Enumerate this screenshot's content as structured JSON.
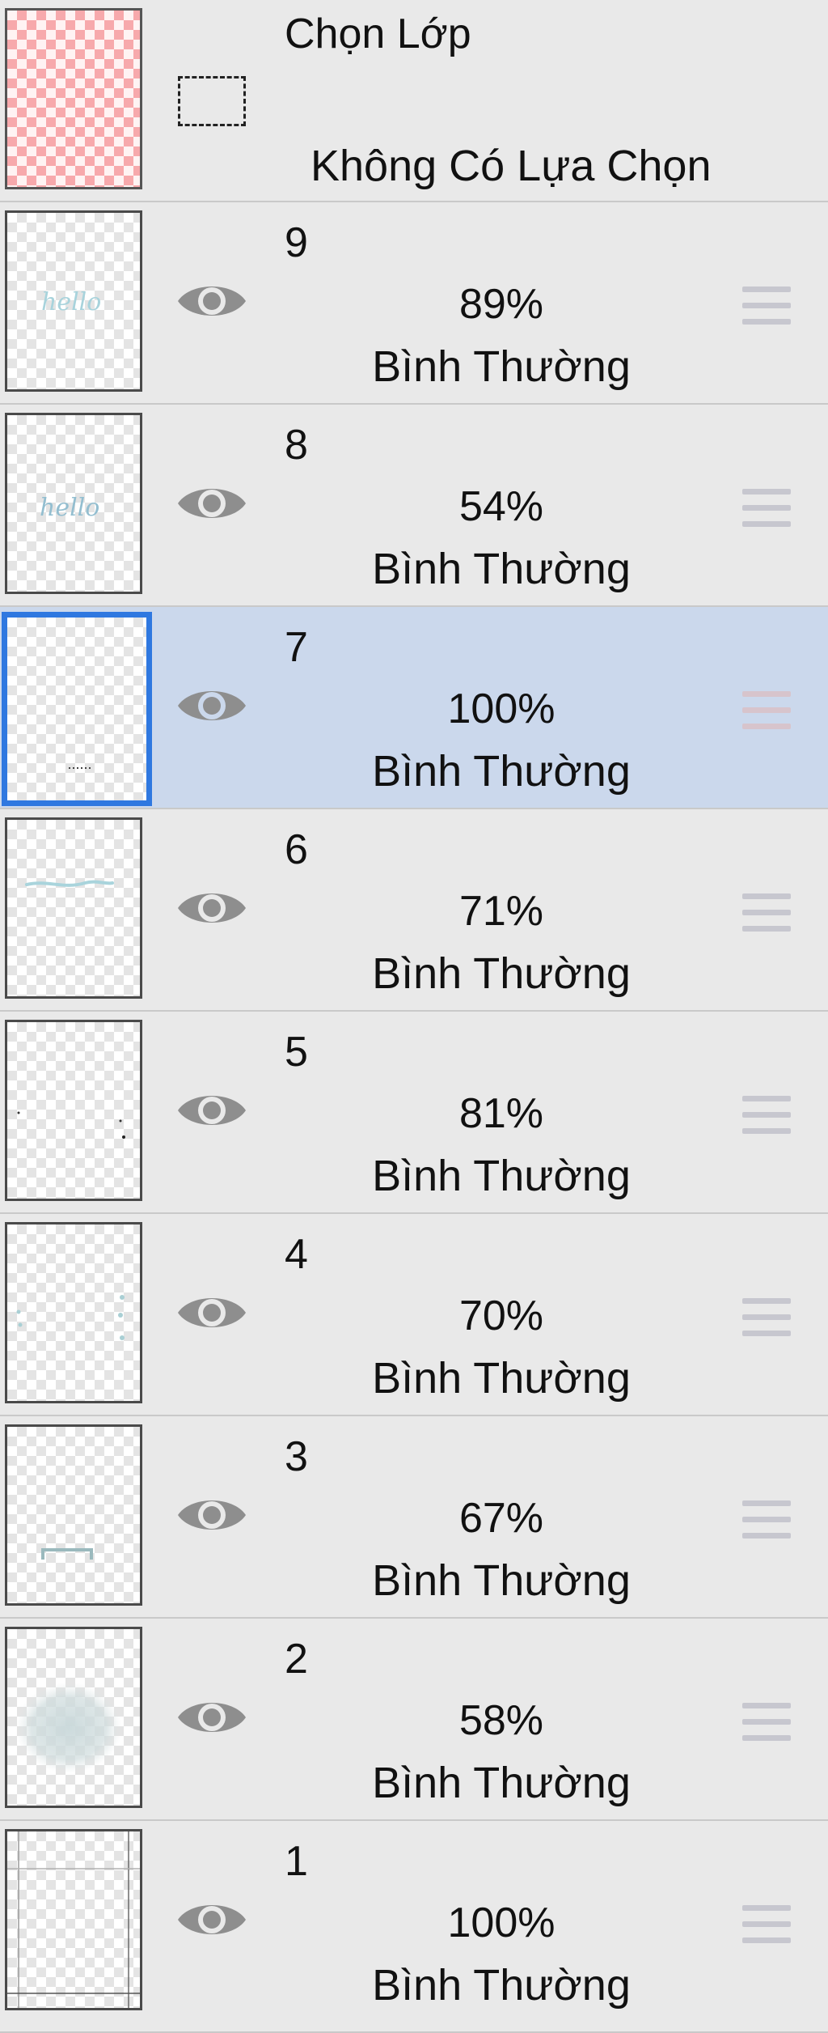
{
  "selection_layer": {
    "title": "Chọn Lớp",
    "status": "Không Có Lựa Chọn",
    "thumbnail_color": "#f7a9ac",
    "icon": "dashed-marquee-icon"
  },
  "layers": [
    {
      "name": "9",
      "opacity": "89%",
      "blend_mode": "Bình Thường",
      "visible": true,
      "selected": false,
      "thumb_art": "hello-text"
    },
    {
      "name": "8",
      "opacity": "54%",
      "blend_mode": "Bình Thường",
      "visible": true,
      "selected": false,
      "thumb_art": "hello-text"
    },
    {
      "name": "7",
      "opacity": "100%",
      "blend_mode": "Bình Thường",
      "visible": true,
      "selected": true,
      "thumb_art": "dots"
    },
    {
      "name": "6",
      "opacity": "71%",
      "blend_mode": "Bình Thường",
      "visible": true,
      "selected": false,
      "thumb_art": "wave-line"
    },
    {
      "name": "5",
      "opacity": "81%",
      "blend_mode": "Bình Thường",
      "visible": true,
      "selected": false,
      "thumb_art": "specks"
    },
    {
      "name": "4",
      "opacity": "70%",
      "blend_mode": "Bình Thường",
      "visible": true,
      "selected": false,
      "thumb_art": "side-dots"
    },
    {
      "name": "3",
      "opacity": "67%",
      "blend_mode": "Bình Thường",
      "visible": true,
      "selected": false,
      "thumb_art": "bracket"
    },
    {
      "name": "2",
      "opacity": "58%",
      "blend_mode": "Bình Thường",
      "visible": true,
      "selected": false,
      "thumb_art": "soft-blob"
    },
    {
      "name": "1",
      "opacity": "100%",
      "blend_mode": "Bình Thường",
      "visible": true,
      "selected": false,
      "thumb_art": "guide-lines"
    }
  ],
  "colors": {
    "panel_bg": "#e9e9e9",
    "selected_row_bg": "#cbd8ec",
    "selected_border": "#2f78e0",
    "eye_icon": "#8e8e8e",
    "handle": "#c7c7cf"
  },
  "icons": {
    "visibility": "eye-icon",
    "reorder": "drag-handle-icon"
  }
}
